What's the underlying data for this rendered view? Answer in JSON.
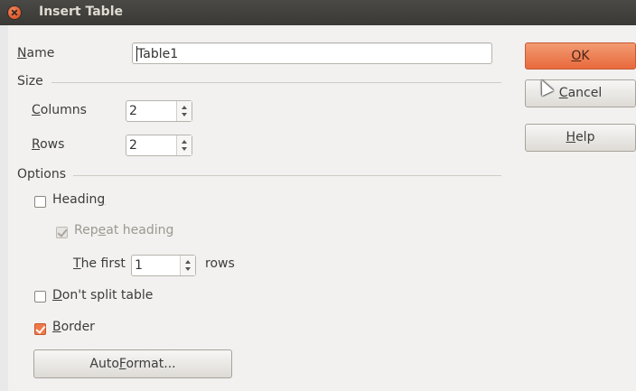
{
  "window": {
    "title": "Insert Table"
  },
  "name": {
    "label_underlined": "N",
    "label_rest": "ame",
    "value": "Table1"
  },
  "size": {
    "section_label": "Size",
    "columns": {
      "label_underlined": "C",
      "label_rest": "olumns",
      "value": "2"
    },
    "rows": {
      "label_underlined": "R",
      "label_rest": "ows",
      "value": "2"
    }
  },
  "options": {
    "section_label": "Options",
    "heading": {
      "label_pre": "Headin",
      "label_underlined": "g",
      "label_post": "",
      "checked": false
    },
    "repeat_heading": {
      "label_pre": "Rep",
      "label_underlined": "e",
      "label_post": "at heading",
      "checked": true,
      "disabled": true
    },
    "the_first": {
      "label_pre": "",
      "label_underlined": "T",
      "label_post": "he first",
      "value": "1",
      "suffix": "rows"
    },
    "dont_split": {
      "label_pre": "",
      "label_underlined": "D",
      "label_post": "on't split table",
      "checked": false
    },
    "border": {
      "label_pre": "",
      "label_underlined": "B",
      "label_post": "order",
      "checked": true
    }
  },
  "buttons": {
    "autoformat": {
      "label_pre": "Auto",
      "label_underlined": "F",
      "label_post": "ormat..."
    },
    "ok": {
      "label_pre": "",
      "label_underlined": "O",
      "label_post": "K"
    },
    "cancel": {
      "label_pre": "",
      "label_underlined": "C",
      "label_post": "ancel"
    },
    "help": {
      "label_pre": "",
      "label_underlined": "H",
      "label_post": "elp"
    }
  },
  "colors": {
    "accent": "#e8693c",
    "titlebar": "#3c3b37",
    "dialog_bg": "#f2f1f0"
  },
  "icons": {
    "close": "close-icon",
    "cursor": "mouse-pointer-icon"
  }
}
